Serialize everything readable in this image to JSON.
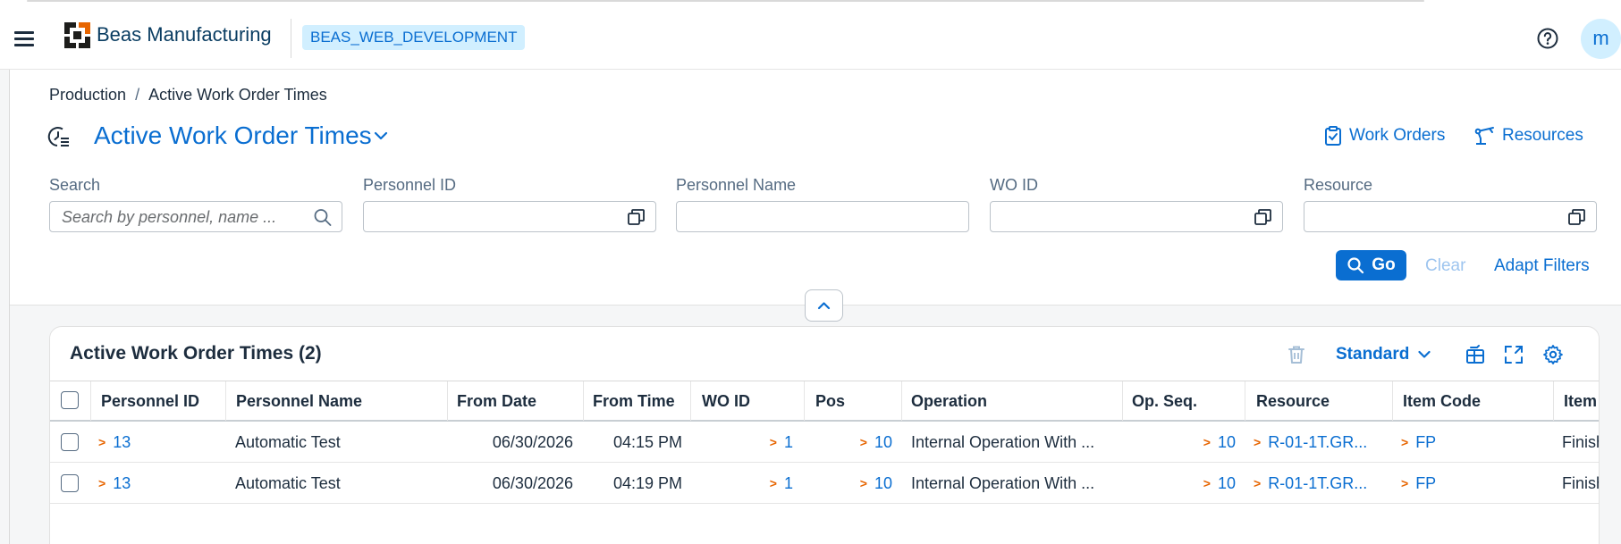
{
  "shell": {
    "app_title": "Beas Manufacturing",
    "environment": "BEAS_WEB_DEVELOPMENT",
    "avatar_initial": "m"
  },
  "breadcrumb": {
    "parent": "Production",
    "separator": "/",
    "current": "Active Work Order Times"
  },
  "page": {
    "title": "Active Work Order Times",
    "links": {
      "work_orders": "Work Orders",
      "resources": "Resources"
    }
  },
  "filters": {
    "search": {
      "label": "Search",
      "placeholder": "Search by personnel, name ..."
    },
    "personnel_id": {
      "label": "Personnel ID",
      "value": ""
    },
    "personnel_name": {
      "label": "Personnel Name",
      "value": ""
    },
    "wo_id": {
      "label": "WO ID",
      "value": ""
    },
    "resource": {
      "label": "Resource",
      "value": ""
    },
    "go_label": "Go",
    "clear_label": "Clear",
    "adapt_label": "Adapt Filters"
  },
  "table": {
    "title": "Active Work Order Times (2)",
    "variant": "Standard",
    "columns": [
      "Personnel ID",
      "Personnel Name",
      "From Date",
      "From Time",
      "WO ID",
      "Pos",
      "Operation",
      "Op. Seq.",
      "Resource",
      "Item Code",
      "Item"
    ],
    "rows": [
      {
        "personnel_id": "13",
        "personnel_name": "Automatic Test",
        "from_date": "06/30/2026",
        "from_time": "04:15 PM",
        "wo_id": "1",
        "pos": "10",
        "operation": "Internal Operation With ...",
        "op_seq": "10",
        "resource": "R-01-1T.GR...",
        "item_code": "FP",
        "item": "Finish"
      },
      {
        "personnel_id": "13",
        "personnel_name": "Automatic Test",
        "from_date": "06/30/2026",
        "from_time": "04:19 PM",
        "wo_id": "1",
        "pos": "10",
        "operation": "Internal Operation With ...",
        "op_seq": "10",
        "resource": "R-01-1T.GR...",
        "item_code": "FP",
        "item": "Finish"
      }
    ]
  },
  "colors": {
    "accent": "#0a6ed1",
    "nav_chevron": "#e76500",
    "badge_bg": "#d1efff",
    "text": "#1d2d3e"
  }
}
